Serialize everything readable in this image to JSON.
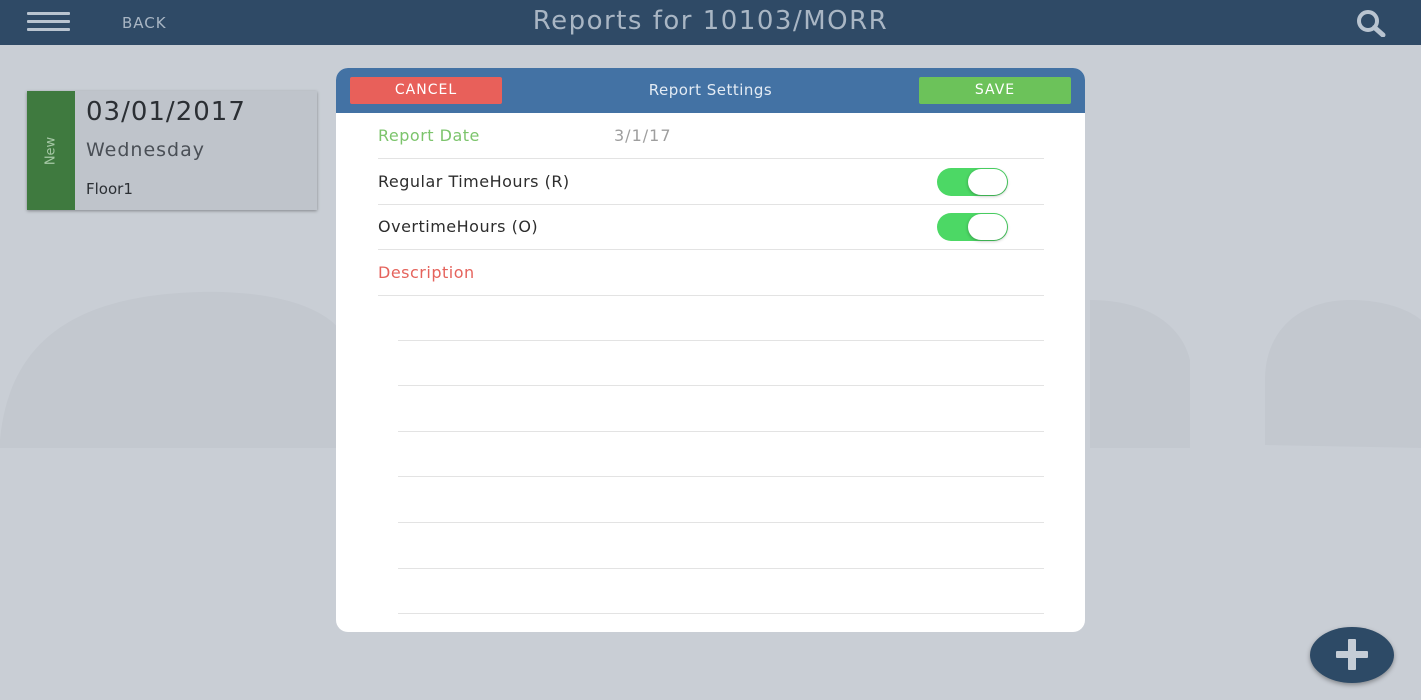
{
  "app": {
    "title": "Reports for 10103/MORR",
    "back_label": "BACK",
    "menu_icon": "hamburger-menu-icon",
    "search_icon": "search-icon"
  },
  "report_card": {
    "status_label": "New",
    "date": "03/01/2017",
    "day": "Wednesday",
    "location": "Floor1",
    "status_color": "#3f7a3f"
  },
  "modal": {
    "title": "Report Settings",
    "cancel_label": "CANCEL",
    "save_label": "SAVE",
    "report_date_label": "Report Date",
    "report_date_value": "3/1/17",
    "regular_label": "Regular TimeHours (R)",
    "regular_on": true,
    "overtime_label": "OvertimeHours (O)",
    "overtime_on": true,
    "description_label": "Description",
    "description_value": ""
  },
  "fab": {
    "icon": "plus-icon"
  },
  "colors": {
    "topbar": "#2f4a66",
    "modal_header": "#4372a4",
    "cancel": "#e8605a",
    "save": "#6cc25a",
    "toggle_on": "#4cd865",
    "background": "#c9ced5"
  }
}
